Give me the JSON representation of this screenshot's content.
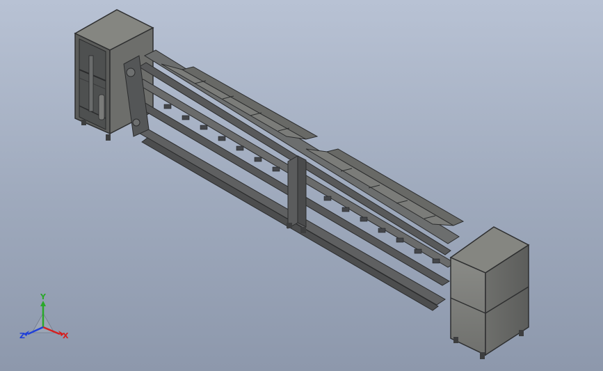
{
  "view": {
    "background_top": "#b8c2d4",
    "background_bottom": "#8d98ac"
  },
  "model": {
    "description_icon": "conveyor-assembly-model",
    "frame_color": "#4a4c4e",
    "panel_color": "#7d7e7c",
    "panel_top_color": "#8e8f8b",
    "rail_color": "#5d5f60"
  },
  "triad": {
    "x_label": "X",
    "y_label": "Y",
    "z_label": "Z",
    "x_color": "#d42020",
    "y_color": "#2aa82a",
    "z_color": "#2040d8"
  }
}
